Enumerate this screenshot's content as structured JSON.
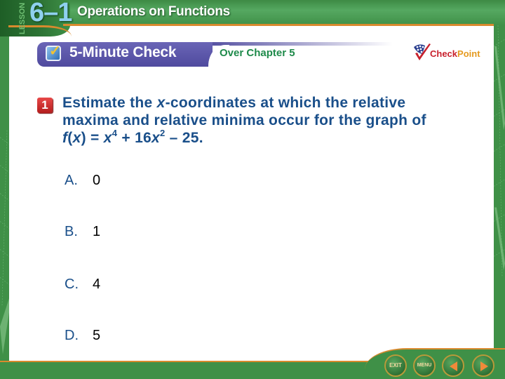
{
  "header": {
    "lesson_label": "LESSON",
    "lesson_number": "6–1",
    "lesson_title": "Operations on Functions"
  },
  "banner": {
    "title": "5-Minute Check",
    "subtitle": "Over Chapter 5",
    "logo_check": "Check",
    "logo_point": "Point"
  },
  "question": {
    "number": "1",
    "line1_pre": "Estimate the ",
    "line1_var": "x",
    "line1_post": "-coordinates at which the relative",
    "line2": "maxima and relative minima occur for the graph of",
    "formula": {
      "f": "f",
      "open": "(",
      "x": "x",
      "mid": ") = ",
      "x2": "x",
      "exp1": "4",
      "plus": " + 16",
      "x3": "x",
      "exp2": "2",
      "tail": " – 25."
    }
  },
  "options": [
    {
      "letter": "A.",
      "value": "0"
    },
    {
      "letter": "B.",
      "value": "1"
    },
    {
      "letter": "C.",
      "value": "4"
    },
    {
      "letter": "D.",
      "value": "5"
    }
  ],
  "nav": {
    "exit_label": "EXIT",
    "menu_label": "MENU"
  },
  "colors": {
    "frame_green": "#3f9047",
    "accent_orange": "#d98a2e",
    "banner_purple": "#5a55a8",
    "question_blue": "#1a4f8a",
    "chapter_green": "#1e8a4a"
  }
}
